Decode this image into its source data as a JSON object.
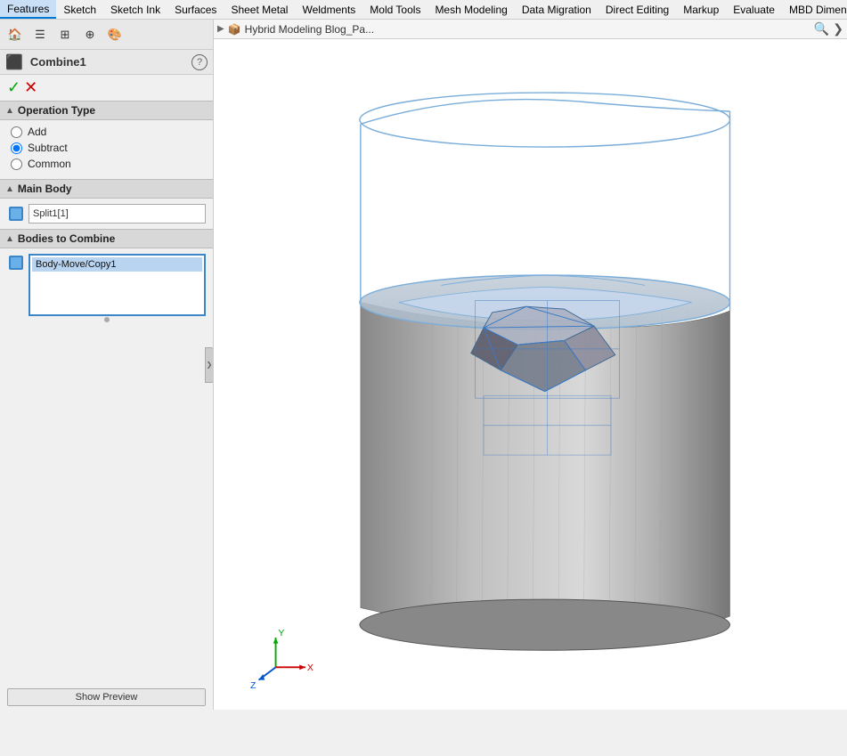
{
  "menu": {
    "items": [
      {
        "label": "Features",
        "active": true
      },
      {
        "label": "Sketch"
      },
      {
        "label": "Sketch Ink"
      },
      {
        "label": "Surfaces"
      },
      {
        "label": "Sheet Metal"
      },
      {
        "label": "Weldments"
      },
      {
        "label": "Mold Tools"
      },
      {
        "label": "Mesh Modeling"
      },
      {
        "label": "Data Migration"
      },
      {
        "label": "Direct Editing",
        "highlighted": true
      },
      {
        "label": "Markup"
      },
      {
        "label": "Evaluate"
      },
      {
        "label": "MBD Dimens"
      }
    ]
  },
  "panel_toolbar": {
    "buttons": [
      {
        "icon": "🏠",
        "name": "home-button"
      },
      {
        "icon": "☰",
        "name": "list-button"
      },
      {
        "icon": "⊞",
        "name": "grid-button"
      },
      {
        "icon": "⊕",
        "name": "add-button"
      },
      {
        "icon": "🎨",
        "name": "color-button"
      }
    ]
  },
  "title_bar": {
    "prefix": "▶",
    "icon": "📦",
    "text": "Hybrid Modeling Blog_Pa...",
    "search_icon": "🔍",
    "more_icon": "❯"
  },
  "feature_panel": {
    "title": "Combine1",
    "help_label": "?",
    "accept_label": "✓",
    "cancel_label": "✕"
  },
  "sections": {
    "operation_type": {
      "title": "Operation Type",
      "options": [
        {
          "label": "Add",
          "value": "add",
          "checked": false
        },
        {
          "label": "Subtract",
          "value": "subtract",
          "checked": true
        },
        {
          "label": "Common",
          "value": "common",
          "checked": false
        }
      ]
    },
    "main_body": {
      "title": "Main Body",
      "value": "Split1[1]",
      "icon_color": "#3a86c8"
    },
    "bodies_to_combine": {
      "title": "Bodies to Combine",
      "items": [
        "Body-Move/Copy1"
      ],
      "icon_color": "#3a86c8"
    }
  },
  "show_preview_label": "Show Preview",
  "colors": {
    "accent_blue": "#3a86c8",
    "selected_bg": "#b8d4f0",
    "header_bg": "#d8d8d8",
    "panel_bg": "#f0f0f0"
  }
}
